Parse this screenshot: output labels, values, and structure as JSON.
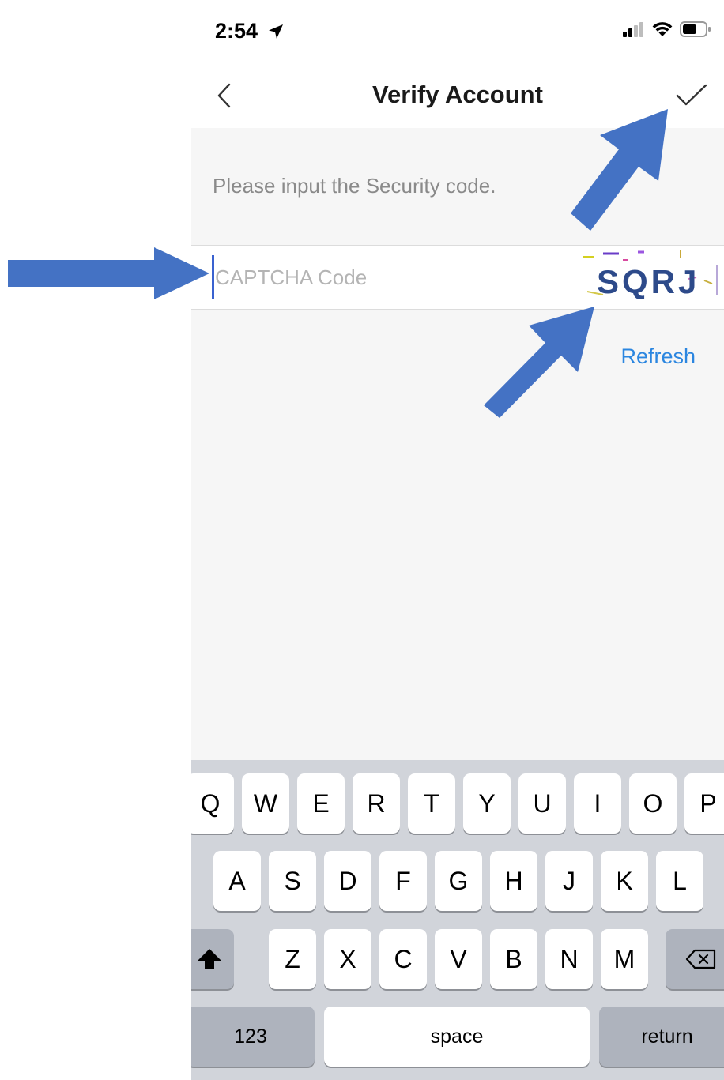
{
  "status": {
    "time": "2:54"
  },
  "nav": {
    "title": "Verify Account"
  },
  "content": {
    "instruction": "Please input the Security code.",
    "captcha_placeholder": "CAPTCHA Code",
    "captcha_image_text": "SQRJ",
    "refresh_label": "Refresh"
  },
  "keyboard": {
    "row1": [
      "Q",
      "W",
      "E",
      "R",
      "T",
      "Y",
      "U",
      "I",
      "O",
      "P"
    ],
    "row2": [
      "A",
      "S",
      "D",
      "F",
      "G",
      "H",
      "J",
      "K",
      "L"
    ],
    "row3": [
      "Z",
      "X",
      "C",
      "V",
      "B",
      "N",
      "M"
    ],
    "numbers_label": "123",
    "space_label": "space",
    "return_label": "return"
  },
  "colors": {
    "accent": "#2b86e0",
    "annotation_arrow": "#4472c4",
    "background": "#f6f6f6",
    "keyboard_bg": "#d1d4da"
  }
}
